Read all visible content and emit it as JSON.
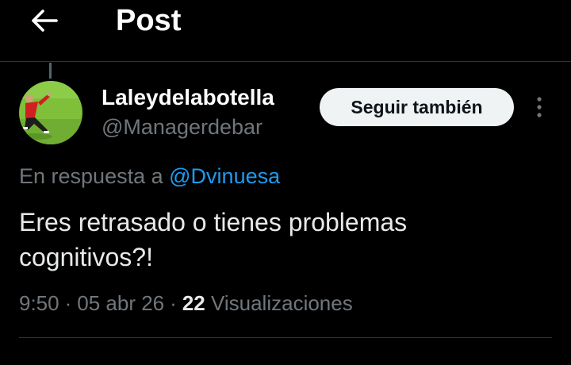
{
  "header": {
    "title": "Post",
    "back_icon": "arrow-left-icon"
  },
  "author": {
    "display_name": "Laleydelabotella",
    "handle": "@Managerdebar",
    "avatar_bg": "#7fbf3a"
  },
  "follow_button": {
    "label": "Seguir también"
  },
  "more_menu": {
    "icon": "more-vertical-icon"
  },
  "reply": {
    "prefix": "En respuesta a",
    "mention": "@Dvinuesa"
  },
  "post": {
    "text": "Eres retrasado o tienes problemas cognitivos?!",
    "time": "9:50",
    "date": "05 abr 26",
    "views_count": "22",
    "views_label": "Visualizaciones"
  },
  "colors": {
    "background": "#000000",
    "text": "#e7e9ea",
    "secondary": "#71767b",
    "link": "#1d9bf0",
    "button_bg": "#eff3f4",
    "divider": "#2f3336"
  }
}
